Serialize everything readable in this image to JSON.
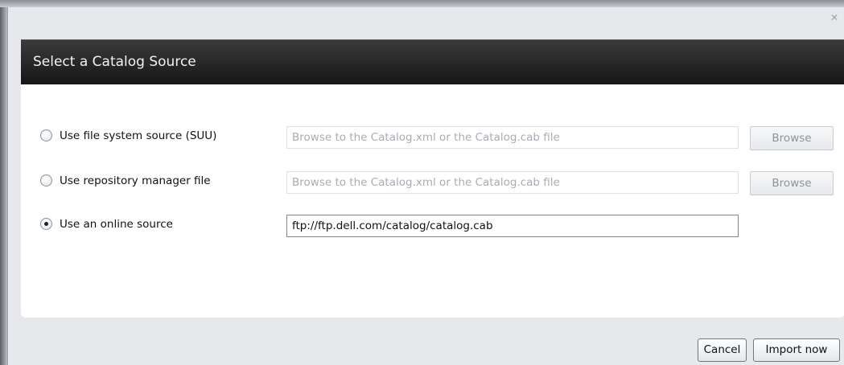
{
  "dialog": {
    "close_icon": "close-icon",
    "title": "Select a Catalog Source"
  },
  "options": [
    {
      "label": "Use file system source (SUU)",
      "selected": false,
      "input_value": "",
      "input_placeholder": "Browse to the Catalog.xml or the Catalog.cab file",
      "browse_label": "Browse"
    },
    {
      "label": "Use repository manager file",
      "selected": false,
      "input_value": "",
      "input_placeholder": "Browse to the Catalog.xml or the Catalog.cab file",
      "browse_label": "Browse"
    },
    {
      "label": "Use an online source",
      "selected": true,
      "input_value": "ftp://ftp.dell.com/catalog/catalog.cab",
      "input_placeholder": ""
    }
  ],
  "footer": {
    "cancel_label": "Cancel",
    "import_label": "Import now"
  }
}
